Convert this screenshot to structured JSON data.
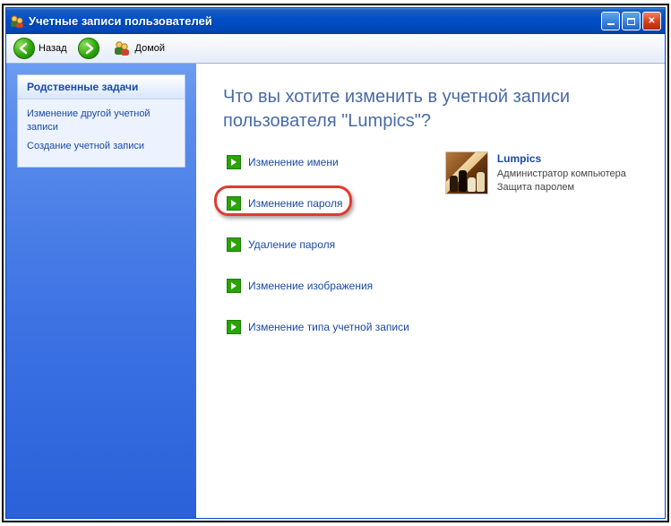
{
  "window": {
    "title": "Учетные записи пользователей"
  },
  "toolbar": {
    "back_label": "Назад",
    "home_label": "Домой"
  },
  "sidebar": {
    "panel_title": "Родственные задачи",
    "links": [
      "Изменение другой учетной записи",
      "Создание учетной записи"
    ]
  },
  "main": {
    "heading": "Что вы хотите изменить в учетной записи пользователя \"Lumpics\"?",
    "actions": [
      {
        "label": "Изменение имени",
        "highlighted": false
      },
      {
        "label": "Изменение пароля",
        "highlighted": true
      },
      {
        "label": "Удаление пароля",
        "highlighted": false
      },
      {
        "label": "Изменение изображения",
        "highlighted": false
      },
      {
        "label": "Изменение типа учетной записи",
        "highlighted": false
      }
    ]
  },
  "user": {
    "name": "Lumpics",
    "role": "Администратор компьютера",
    "protection": "Защита паролем"
  }
}
